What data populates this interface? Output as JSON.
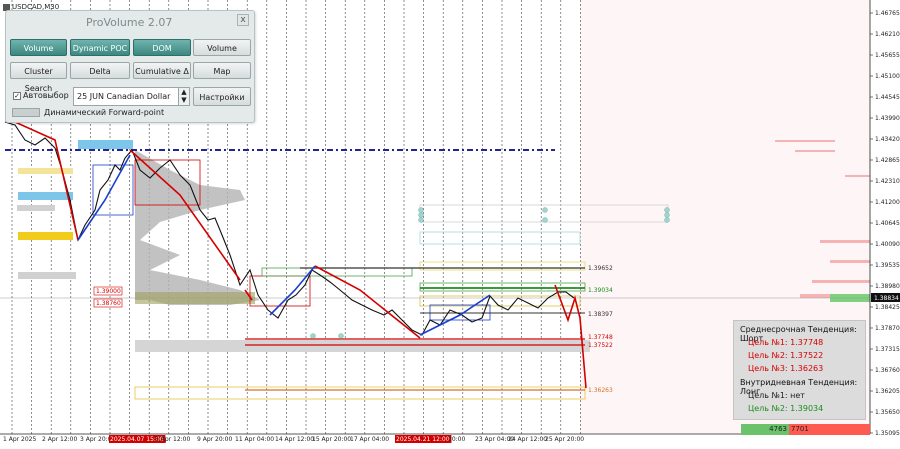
{
  "symbol": "USDCAD,M30",
  "panel": {
    "title": "ProVolume 2.07",
    "close_label": "x",
    "buttons": [
      "Volume Profile",
      "Dynamic POC",
      "DOM",
      "Volume",
      "Cluster Search",
      "Delta",
      "Cumulative Δ",
      "Map"
    ],
    "active_buttons": [
      0,
      1,
      2
    ],
    "auto_select_label": "Автовыбор",
    "auto_select_checked": true,
    "instrument": "25 JUN Canadian Dollar",
    "settings_label": "Настройки",
    "forward_label": "Динамический Forward-point"
  },
  "price_axis": [
    "1.46765",
    "1.46210",
    "1.45655",
    "1.45100",
    "1.44545",
    "1.43990",
    "1.43420",
    "1.42865",
    "1.42310",
    "1.41200",
    "1.40645",
    "1.40090",
    "1.39535",
    "1.38980",
    "1.38425",
    "1.37870",
    "1.37315",
    "1.36760",
    "1.36205",
    "1.35650",
    "1.35095"
  ],
  "current_price": "1.38834",
  "time_axis": [
    "1 Apr 2025",
    "2 Apr 12:00",
    "3 Apr 20:00",
    "2025.04.07 15:00",
    "8 Apr 12:00",
    "9 Apr 20:00",
    "11 Apr 04:00",
    "14 Apr 12:00",
    "15 Apr 20:00",
    "17 Apr 04:00",
    "2025.04.21 12:00",
    "20:00",
    "23 Apr 04:00",
    "24 Apr 12:00",
    "25 Apr 20:00"
  ],
  "time_highlights": [
    3,
    10
  ],
  "level_labels": [
    "1.39652",
    "1.39034",
    "1.38397",
    "1.37748",
    "1.37522",
    "1.36263"
  ],
  "poc_labels": [
    "1.39000",
    "1.38760"
  ],
  "info": {
    "mid_trend": "Среднесрочная Тенденция: Шорт",
    "mid_targets": [
      "Цель №1: 1.37748",
      "Цель №2: 1.37522",
      "Цель №3: 1.36263"
    ],
    "intra_trend": "Внутридневная Тенденция: Лонг",
    "intra_targets": [
      "Цель №1: нет",
      "Цель №2: 1.39034"
    ]
  },
  "volumes": {
    "buy": "4763",
    "sell": "7701"
  },
  "colors": {
    "bear": "#d40000",
    "bull": "#1a3ed0",
    "up_target": "#1e8c1e",
    "down_target": "#d40000",
    "poc": "#22229a"
  }
}
